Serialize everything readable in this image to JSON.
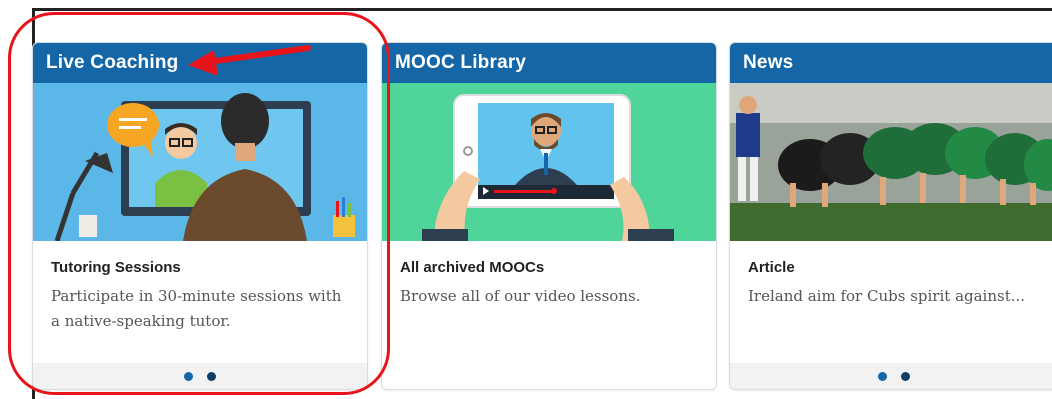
{
  "colors": {
    "header_blue": "#1466a6",
    "annotation_red": "#e8141c",
    "live_bg": "#5bb7e8",
    "mooc_bg": "#4fd59a",
    "footer_bg": "#f2f2f2"
  },
  "cards": [
    {
      "header": "Live Coaching",
      "image": "video-call-illustration",
      "title": "Tutoring Sessions",
      "description": "Participate in 30-minute sessions with a native-speaking tutor.",
      "pagination_dots": 2
    },
    {
      "header": "MOOC Library",
      "image": "tablet-video-illustration",
      "title": "All archived MOOCs",
      "description": "Browse all of our video lessons.",
      "pagination_dots": 0
    },
    {
      "header": "News",
      "image": "rugby-scrum-photo",
      "title": "Article",
      "description": "Ireland aim for Cubs spirit against...",
      "pagination_dots": 2
    }
  ],
  "annotations": {
    "highlight": "red-circle",
    "pointer": "red-arrow"
  }
}
